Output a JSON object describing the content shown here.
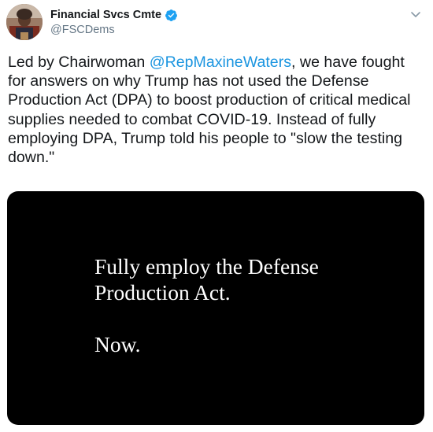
{
  "account": {
    "display_name": "Financial Svcs Cmte",
    "handle": "@FSCDems",
    "verified": true,
    "verified_color": "#1da1f2"
  },
  "tweet": {
    "text_part1": "Led by Chairwoman ",
    "mention": "@RepMaxineWaters",
    "text_part2": ", we have fought for answers on why Trump has not used the Defense Production Act (DPA) to boost production of critical medical supplies needed to combat COVID-19. Instead of fully employing DPA, Trump told his people to \"slow the testing down.\"",
    "mention_color": "#1b95e0"
  },
  "media": {
    "line1": "Fully employ the Defense",
    "line2": "Production Act.",
    "line3": "Now.",
    "background": "#000000",
    "text_color": "#ffffff"
  },
  "icons": {
    "avatar": "profile-photo",
    "verified": "verified-badge-icon",
    "menu": "chevron-down-icon"
  }
}
